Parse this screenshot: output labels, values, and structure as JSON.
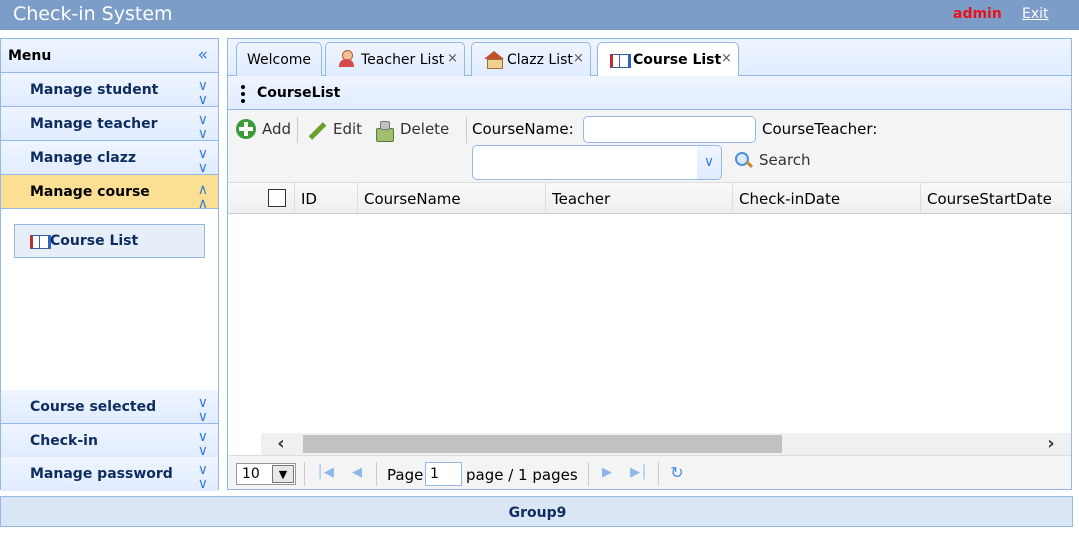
{
  "header": {
    "title": "Check-in System",
    "user": "admin",
    "exit_label": "Exit"
  },
  "sidebar": {
    "title": "Menu",
    "items": [
      {
        "label": "Manage student"
      },
      {
        "label": "Manage teacher"
      },
      {
        "label": "Manage clazz"
      },
      {
        "label": "Manage course"
      },
      {
        "label": "Course selected"
      },
      {
        "label": "Check-in"
      },
      {
        "label": "Manage password"
      }
    ],
    "active_item": "Manage course",
    "sub_link": "Course List"
  },
  "tabs": [
    {
      "label": "Welcome"
    },
    {
      "label": "Teacher List"
    },
    {
      "label": "Clazz List"
    },
    {
      "label": "Course List"
    }
  ],
  "panel": {
    "title": "CourseList"
  },
  "toolbar": {
    "add_label": "Add",
    "edit_label": "Edit",
    "delete_label": "Delete",
    "course_name_label": "CourseName:",
    "course_name_value": "",
    "course_teacher_label": "CourseTeacher:",
    "course_teacher_value": "",
    "search_label": "Search"
  },
  "grid": {
    "columns": [
      "ID",
      "CourseName",
      "Teacher",
      "Check-inDate",
      "CourseStartDate"
    ],
    "rows": []
  },
  "pager": {
    "page_size": "10",
    "page_label": "Page",
    "page_value": "1",
    "page_suffix": "page / 1 pages"
  },
  "footer": {
    "text": "Group9"
  },
  "colors": {
    "header_bg": "#7b9dc8",
    "accent_border": "#95b8e7",
    "active_menu": "#fbe094",
    "admin_red": "#e8121d"
  }
}
